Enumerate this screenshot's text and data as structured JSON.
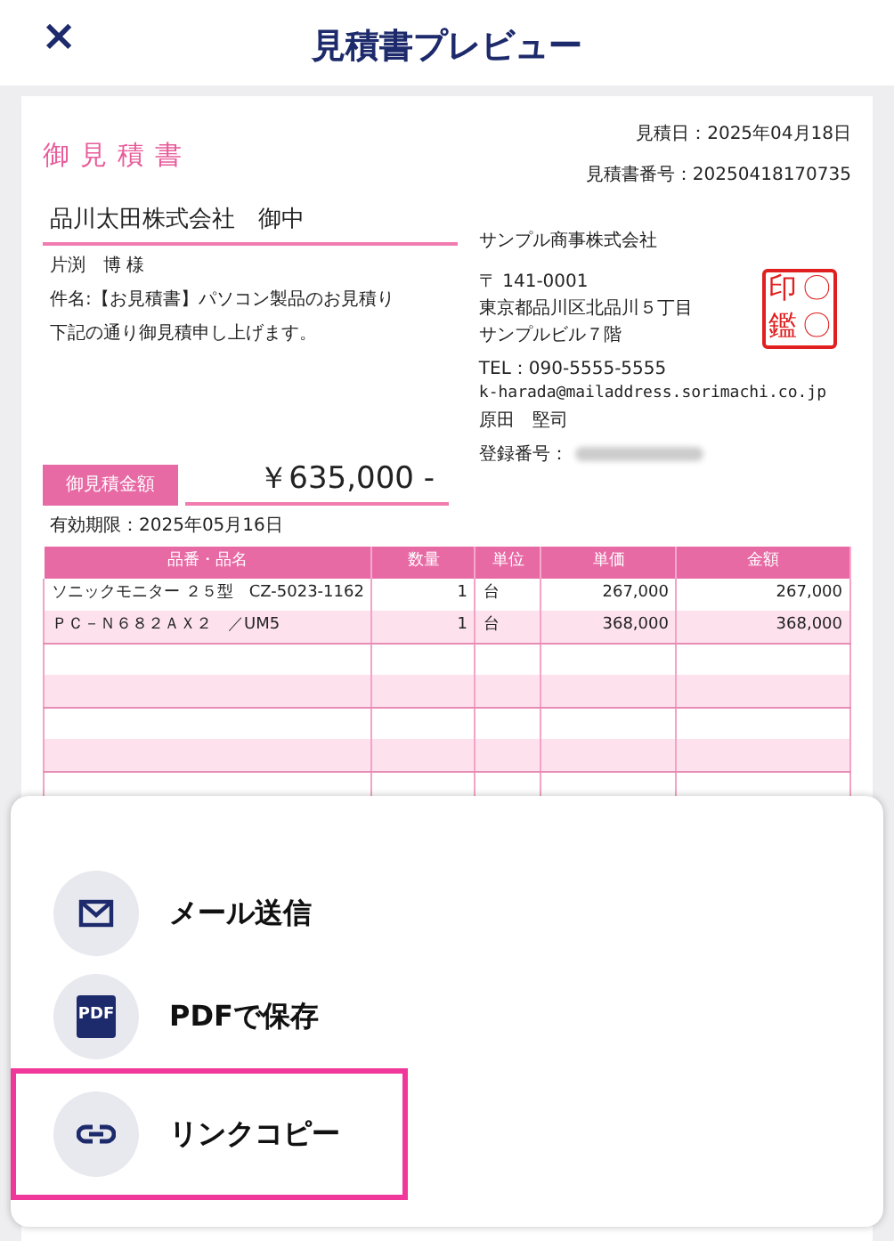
{
  "header": {
    "close": "×",
    "title": "見積書プレビュー"
  },
  "document": {
    "title": "御見積書",
    "meta": [
      "見積日：2025年04月18日",
      "見積書番号：20250418170735"
    ],
    "customer": "品川太田株式会社　御中",
    "contact": "片渕　博 様",
    "subject": "件名:【お見積書】パソコン製品のお見積り",
    "intro": "下記の通り御見積申し上げます。",
    "total_label": "御見積金額",
    "total": "￥635,000 -",
    "valid_until": "有効期限：2025年05月16日",
    "issuer": {
      "company": "サンプル商事株式会社",
      "address": [
        "〒 141-0001",
        "東京都品川区北品川５丁目",
        "サンプルビル７階"
      ],
      "contact": [
        "TEL：090-5555-5555",
        "k-harada@mailaddress.sorimachi.co.jp",
        "原田　堅司"
      ],
      "registration_label": "登録番号：",
      "stamp": [
        "印",
        "〇",
        "鑑",
        "〇"
      ]
    },
    "table": {
      "columns": [
        "品番・品名",
        "数量",
        "単位",
        "単価",
        "金額"
      ],
      "rows": [
        [
          "ソニックモニター ２５型　CZ-5023-1162",
          "1",
          "台",
          "267,000",
          "267,000"
        ],
        [
          "ＰＣ－Ｎ６８２ＡＸ２　／UM5",
          "1",
          "台",
          "368,000",
          "368,000"
        ]
      ]
    }
  },
  "actions": [
    {
      "kind": "mail",
      "label": "メール送信",
      "highlighted": false
    },
    {
      "kind": "pdf",
      "label": "PDFで保存",
      "icon_text": "PDF",
      "highlighted": false
    },
    {
      "kind": "link",
      "label": "リンクコピー",
      "highlighted": true
    }
  ]
}
